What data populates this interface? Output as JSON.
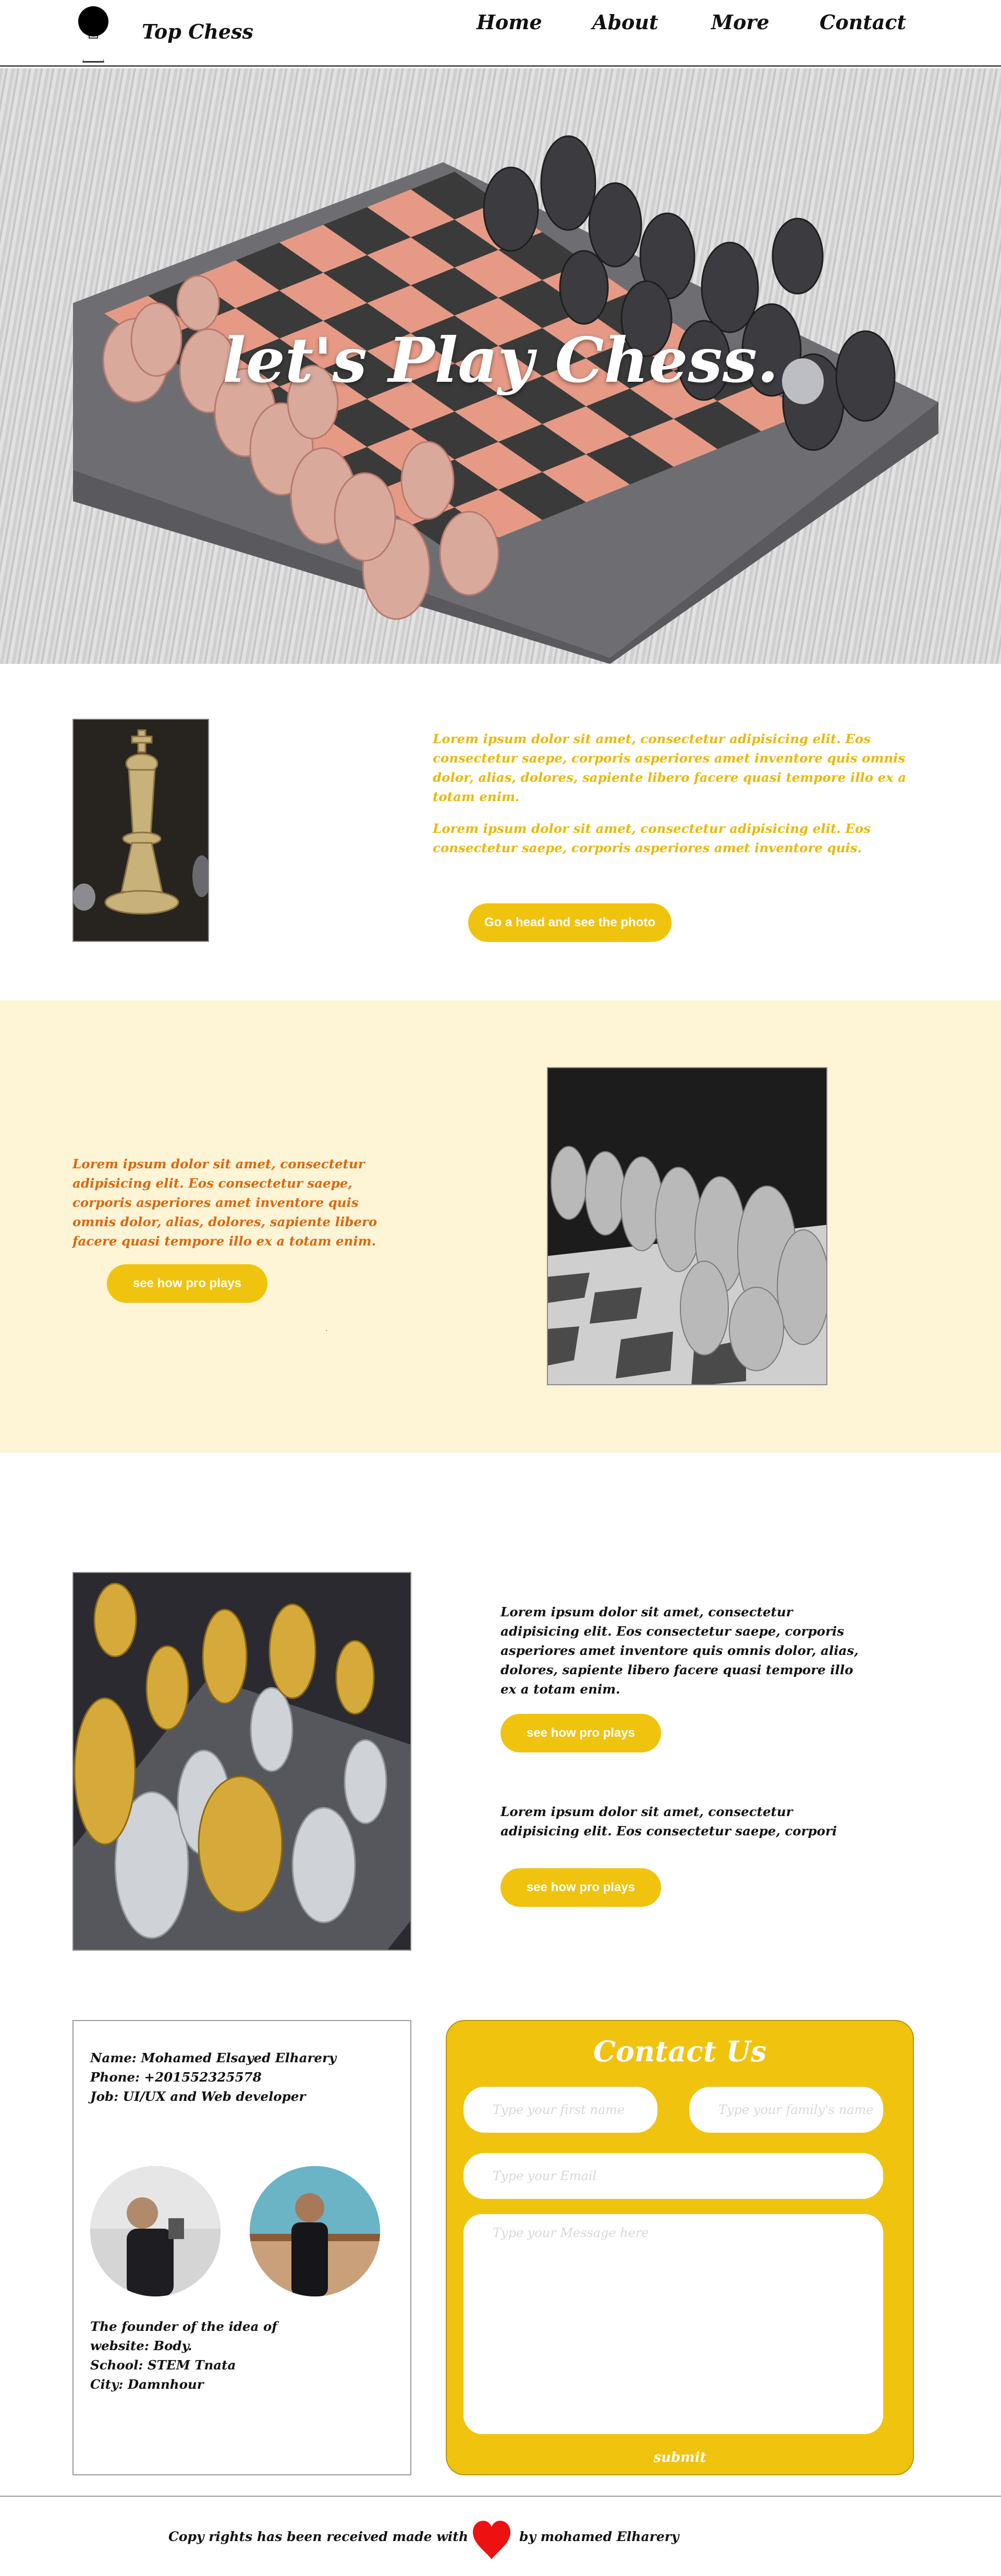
{
  "brand": {
    "name": "Top Chess"
  },
  "nav": {
    "home": "Home",
    "about": "About",
    "more": "More",
    "contact": "Contact"
  },
  "hero": {
    "title": "let's Play Chess."
  },
  "section1": {
    "para1": "Lorem ipsum dolor sit amet, consectetur adipisicing elit. Eos consectetur saepe, corporis asperiores amet inventore quis omnis dolor, alias, dolores, sapiente libero facere quasi tempore illo ex a totam enim.",
    "para2": "Lorem ipsum dolor sit amet, consectetur adipisicing elit. Eos consectetur saepe, corporis asperiores amet inventore quis.",
    "button": "Go a head and see the photo"
  },
  "section2": {
    "para": "Lorem ipsum dolor sit amet, consectetur adipisicing elit. Eos consectetur saepe, corporis asperiores amet inventore quis omnis dolor, alias, dolores, sapiente libero facere quasi tempore illo ex a totam enim.",
    "button": "see how pro plays",
    "dot": "."
  },
  "section3": {
    "para1": "Lorem ipsum dolor sit amet, consectetur adipisicing elit. Eos consectetur saepe, corporis asperiores amet inventore quis omnis dolor, alias, dolores, sapiente libero facere quasi tempore illo ex a totam enim.",
    "button1": "see how pro plays",
    "para2": "Lorem ipsum dolor sit amet, consectetur adipisicing elit. Eos consectetur saepe, corpori",
    "button2": "see how pro plays"
  },
  "profile": {
    "name": "Name: Mohamed Elsayed Elharery",
    "phone": "Phone: +201552325578",
    "job": "Job: UI/UX and Web developer",
    "founder": "The founder of the idea of website: Body.",
    "school": "School: STEM Tnata",
    "city": "City: Damnhour"
  },
  "contact": {
    "title": "Contact Us",
    "first_name_placeholder": "Type your first name",
    "family_name_placeholder": "Type your family's name",
    "email_placeholder": "Type your Email",
    "message_placeholder": "Type your Message here",
    "submit": "submit"
  },
  "footer": {
    "left": "Copy rights has been received made with",
    "right": "by mohamed Elharery"
  },
  "colors": {
    "accent": "#f0c30f",
    "cream": "#fef4d6",
    "orange_text": "#d9680d",
    "gold_text": "#e8b90c",
    "heart": "#ee1111"
  },
  "icons": {
    "logo": "chess-pawn-icon",
    "heart": "heart-icon"
  }
}
